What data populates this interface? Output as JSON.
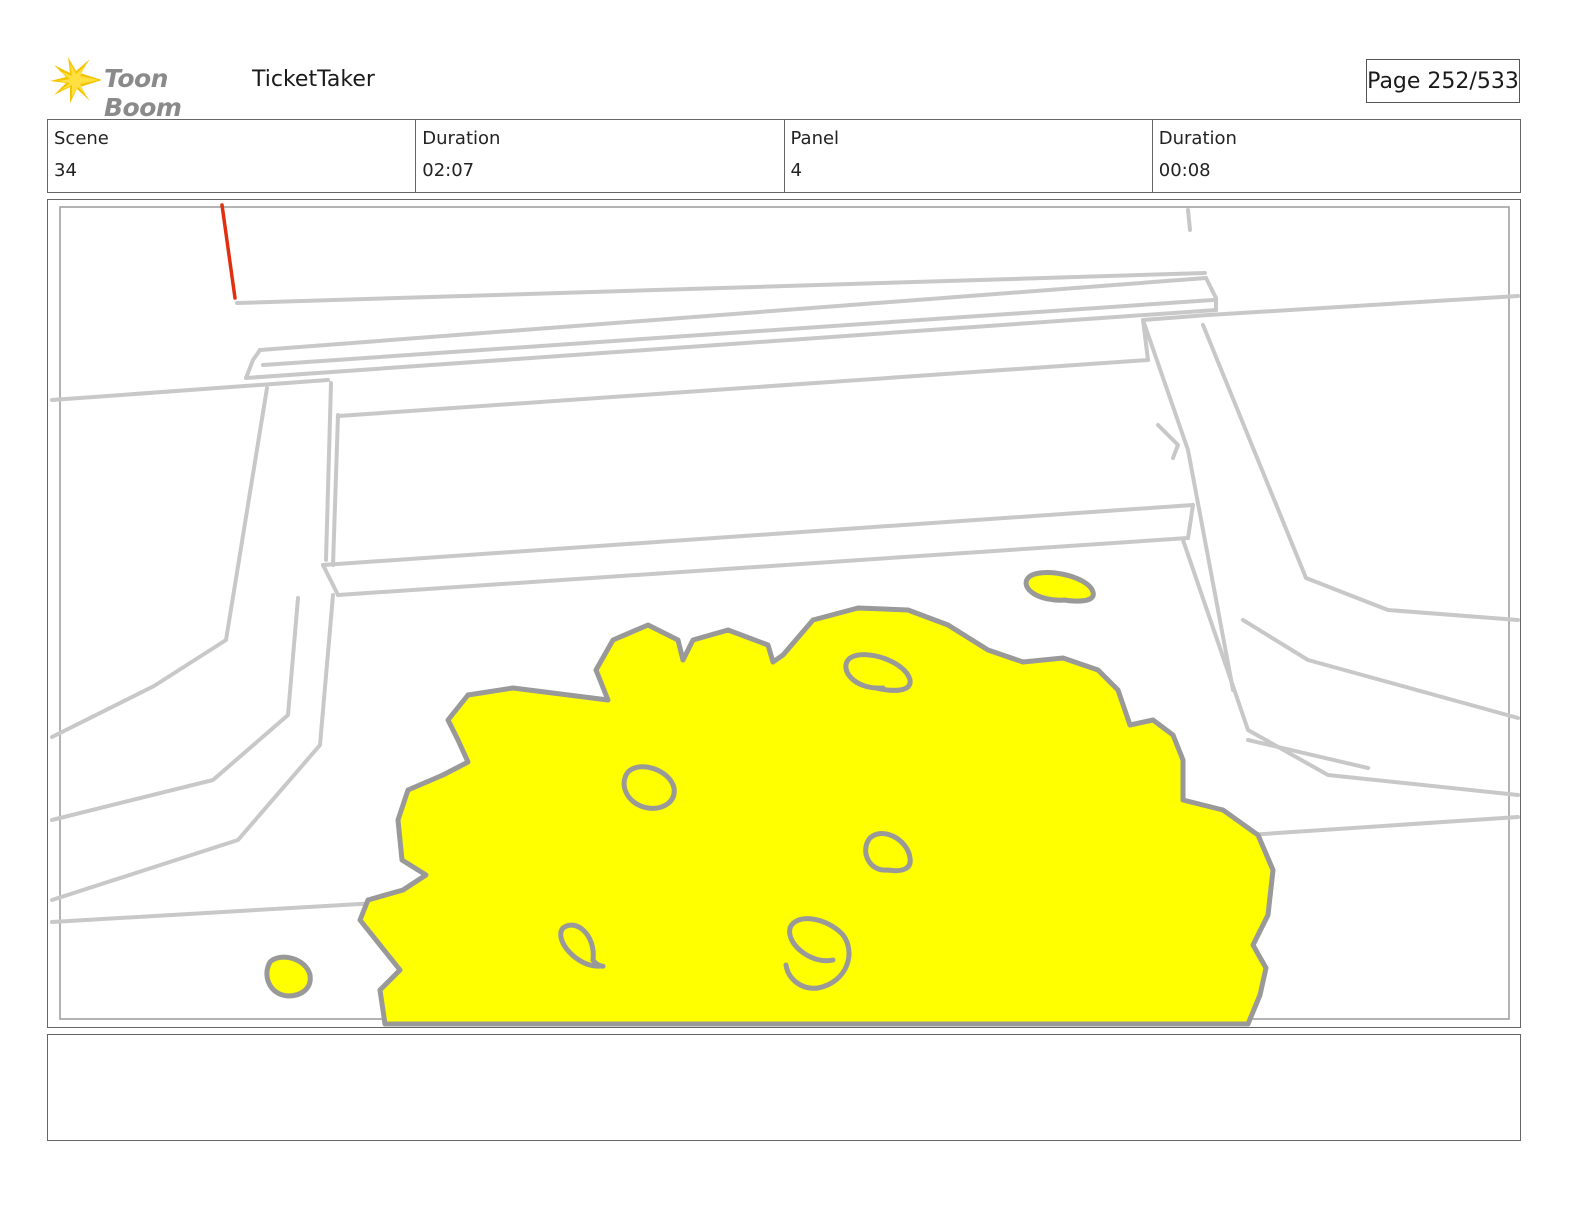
{
  "header": {
    "logo_text": "Toon Boom",
    "project_name": "TicketTaker",
    "page_label": "Page 252/533"
  },
  "info": {
    "scene_label": "Scene",
    "scene_value": "34",
    "scene_duration_label": "Duration",
    "scene_duration_value": "02:07",
    "panel_label": "Panel",
    "panel_value": "4",
    "panel_duration_label": "Duration",
    "panel_duration_value": "00:08"
  },
  "panel": {
    "sketch_line_color": "#c8c8c8",
    "cloud_fill_color": "#ffff00",
    "cloud_outline_color": "#999999",
    "accent_line_color": "#e03010"
  },
  "notes": {
    "text": ""
  }
}
